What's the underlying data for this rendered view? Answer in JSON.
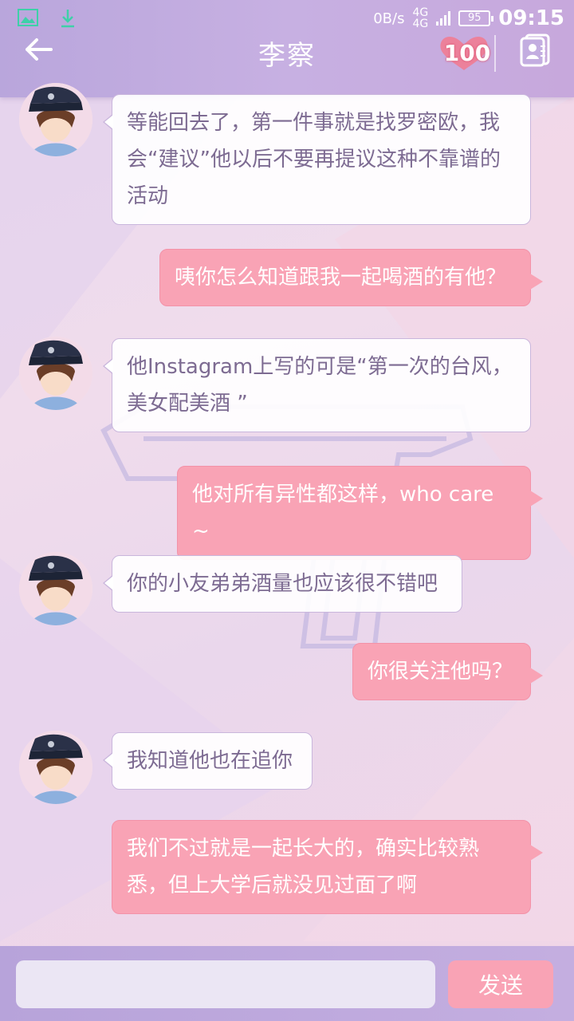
{
  "statusbar": {
    "speed": "0B/s",
    "network_top": "4G",
    "network_bottom": "4G",
    "battery": "95",
    "time": "09:15",
    "icons": [
      "image-icon",
      "download-icon",
      "signal-icon",
      "battery-icon"
    ]
  },
  "header": {
    "title": "李察",
    "heart_count": "100",
    "icons": [
      "back-arrow-icon",
      "heart-icon",
      "contact-card-icon"
    ]
  },
  "messages": [
    {
      "side": "left",
      "text": "等能回去了，第一件事就是找罗密欧，我会“建议”他以后不要再提议这种不靠谱的活动"
    },
    {
      "side": "right",
      "text": "咦你怎么知道跟我一起喝酒的有他？"
    },
    {
      "side": "left",
      "text": "他Instagram上写的可是“第一次的台风，美女配美酒 ”"
    },
    {
      "side": "right",
      "text": "他对所有异性都这样，who care ~"
    },
    {
      "side": "left",
      "text": "你的小友弟弟酒量也应该很不错吧"
    },
    {
      "side": "right",
      "text": "你很关注他吗？"
    },
    {
      "side": "left",
      "text": "我知道他也在追你"
    },
    {
      "side": "right",
      "text": "我们不过就是一起长大的，确实比较熟悉，但上大学后就没见过面了啊"
    }
  ],
  "input": {
    "value": "",
    "placeholder": "",
    "send_label": "发送"
  },
  "colors": {
    "header": "#c3ade0",
    "bubble_right": "#f9a3b5",
    "bubble_left_text": "#7d6b92"
  }
}
